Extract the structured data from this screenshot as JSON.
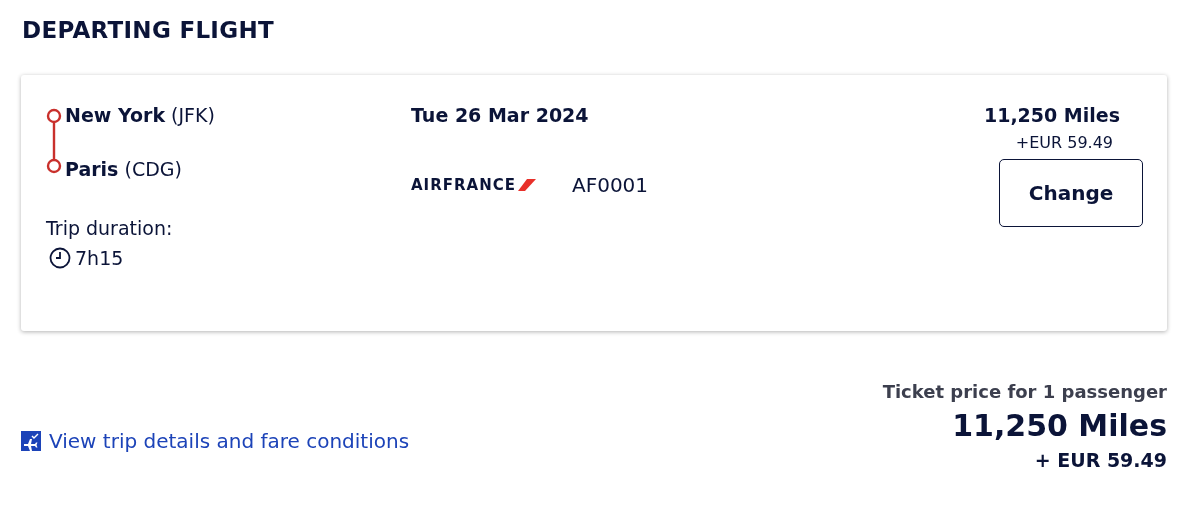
{
  "heading": "DEPARTING FLIGHT",
  "flight": {
    "stops": [
      {
        "city": "New York",
        "code": "(JFK)"
      },
      {
        "city": "Paris",
        "code": "(CDG)"
      }
    ],
    "duration_label": "Trip duration:",
    "duration": "7h15",
    "date": "Tue 26 Mar 2024",
    "airline": "AIRFRANCE",
    "flight_number": "AF0001",
    "miles": "11,250 Miles",
    "surcharge": "+EUR 59.49",
    "change_button": "Change"
  },
  "details_link": "View trip details and fare conditions",
  "total": {
    "label": "Ticket price for 1 passenger",
    "miles": "11,250 Miles",
    "surcharge": "+ EUR 59.49"
  }
}
